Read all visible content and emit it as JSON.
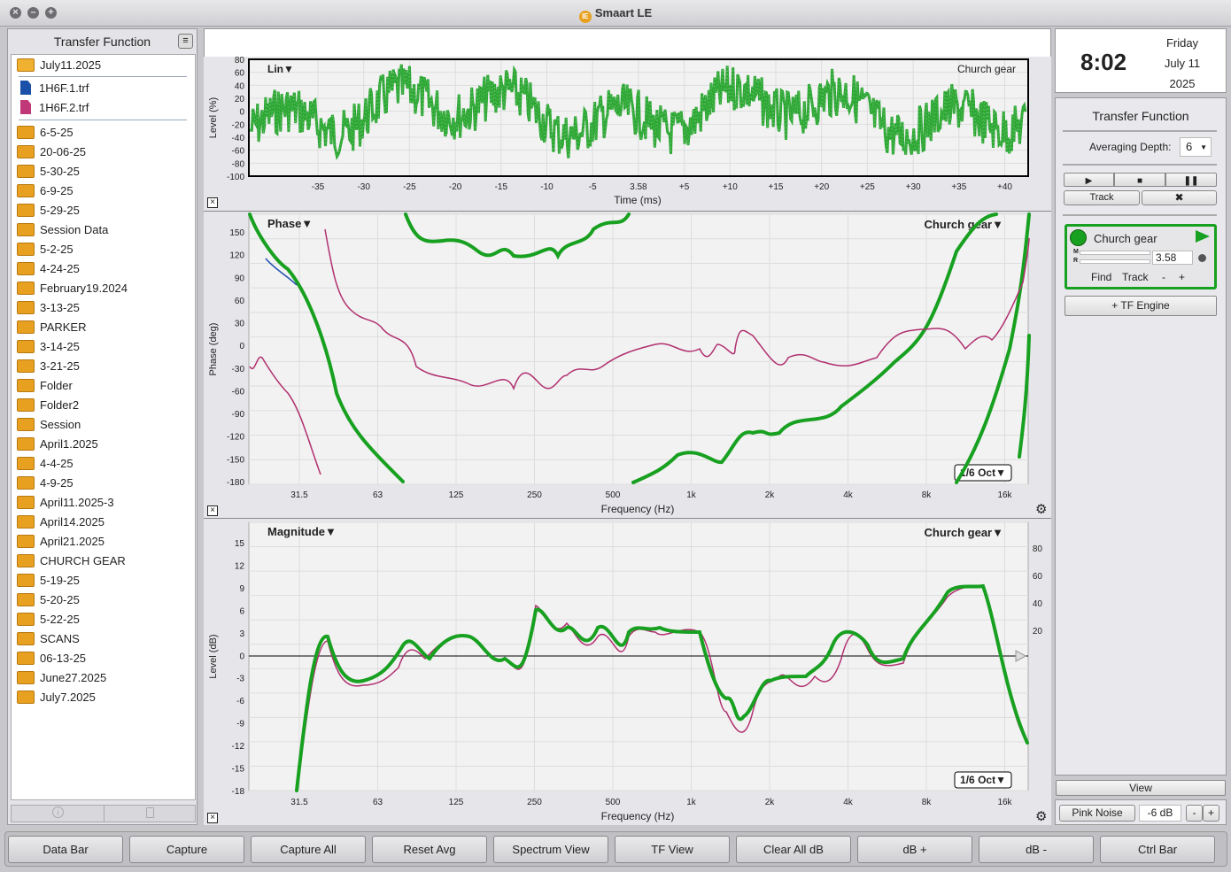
{
  "window": {
    "title": "Smaart LE",
    "logo": "IE"
  },
  "left_panel": {
    "title": "Transfer Function",
    "session": "July11.2025",
    "files": [
      {
        "name": "1H6F.1.trf",
        "color": "#1a50a8"
      },
      {
        "name": "1H6F.2.trf",
        "color": "#c03878"
      }
    ],
    "folders": [
      "6-5-25",
      "20-06-25",
      "5-30-25",
      "6-9-25",
      "5-29-25",
      "Session Data",
      "5-2-25",
      "4-24-25",
      "February19.2024",
      "3-13-25",
      "PARKER",
      "3-14-25",
      "3-21-25",
      "Folder",
      "Folder2",
      "Session",
      "April1.2025",
      "4-4-25",
      "4-9-25",
      "April11.2025-3",
      "April14.2025",
      "April21.2025",
      "CHURCH GEAR",
      "5-19-25",
      "5-20-25",
      "5-22-25",
      "SCANS",
      "06-13-25",
      "June27.2025",
      "July7.2025"
    ],
    "footer_icons": [
      "info-icon",
      "trash-icon"
    ]
  },
  "ir_plot": {
    "scale_label": "Lin",
    "trace_label": "Church gear",
    "ylabel": "Level (%)",
    "xlabel": "Time (ms)",
    "yticks": [
      "80",
      "60",
      "40",
      "20",
      "0",
      "-20",
      "-40",
      "-60",
      "-80",
      "-100"
    ],
    "xticks": [
      "-35",
      "-30",
      "-25",
      "-20",
      "-15",
      "-10",
      "-5",
      "3.58",
      "+5",
      "+10",
      "+15",
      "+20",
      "+25",
      "+30",
      "+35",
      "+40"
    ]
  },
  "phase_plot": {
    "title": "Phase",
    "trace_label": "Church gear",
    "ylabel": "Phase (deg)",
    "xlabel": "Frequency (Hz)",
    "smoothing": "1/6 Oct",
    "yticks": [
      "150",
      "120",
      "90",
      "60",
      "30",
      "0",
      "-30",
      "-60",
      "-90",
      "-120",
      "-150",
      "-180"
    ],
    "xticks": [
      "31.5",
      "63",
      "125",
      "250",
      "500",
      "1k",
      "2k",
      "4k",
      "8k",
      "16k"
    ]
  },
  "mag_plot": {
    "title": "Magnitude",
    "trace_label": "Church gear",
    "ylabel": "Level (dB)",
    "xlabel": "Frequency (Hz)",
    "smoothing": "1/6 Oct",
    "yticks": [
      "15",
      "12",
      "9",
      "6",
      "3",
      "0",
      "-3",
      "-6",
      "-9",
      "-12",
      "-15",
      "-18"
    ],
    "yticks_right": [
      "80",
      "60",
      "40",
      "20"
    ],
    "xticks": [
      "31.5",
      "63",
      "125",
      "250",
      "500",
      "1k",
      "2k",
      "4k",
      "8k",
      "16k"
    ]
  },
  "right_panel": {
    "clock": {
      "time": "8:02",
      "day": "Friday",
      "date": "July 11",
      "year": "2025"
    },
    "tf_title": "Transfer Function",
    "avg_label": "Averaging Depth:",
    "avg_value": "6",
    "track_label": "Track",
    "measurement": {
      "name": "Church gear",
      "delay": "3.58",
      "m": "M",
      "r": "R",
      "find": "Find",
      "track": "Track",
      "minus": "-",
      "plus": "+"
    },
    "add_engine": "+ TF Engine",
    "view_label": "View",
    "pink_noise": "Pink Noise",
    "level": "-6 dB",
    "level_minus": "-",
    "level_plus": "+"
  },
  "bottom_buttons": [
    "Data Bar",
    "Capture",
    "Capture All",
    "Reset Avg",
    "Spectrum View",
    "TF View",
    "Clear All dB",
    "dB +",
    "dB -",
    "Ctrl Bar"
  ],
  "colors": {
    "green": "#18a020",
    "magenta": "#b03070",
    "blue": "#2050b0"
  }
}
